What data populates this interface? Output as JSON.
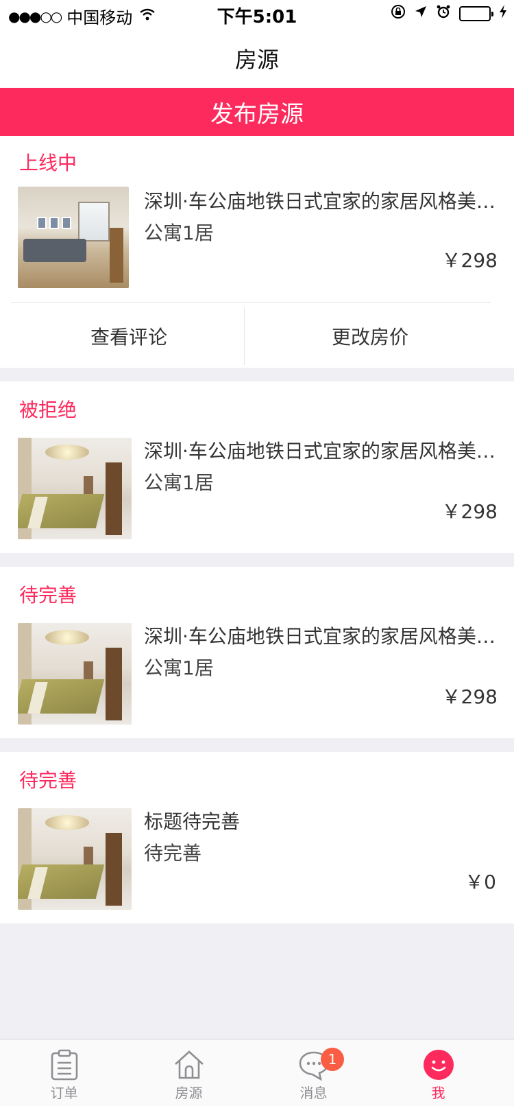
{
  "status_bar": {
    "signal": "●●●○○",
    "carrier": "中国移动",
    "time": "下午5:01"
  },
  "nav": {
    "title": "房源"
  },
  "publish_button": {
    "label": "发布房源"
  },
  "listings": [
    {
      "status": "上线中",
      "title": "深圳·车公庙地铁日式宜家的家居风格美式舒适",
      "type": "公寓1居",
      "price": "￥298",
      "actions": {
        "left": "查看评论",
        "right": "更改房价"
      }
    },
    {
      "status": "被拒绝",
      "title": "深圳·车公庙地铁日式宜家的家居风格美式舒适",
      "type": "公寓1居",
      "price": "￥298"
    },
    {
      "status": "待完善",
      "title": "深圳·车公庙地铁日式宜家的家居风格美式舒适",
      "type": "公寓1居",
      "price": "￥298"
    },
    {
      "status": "待完善",
      "title": "标题待完善",
      "type": "待完善",
      "price": "￥0"
    }
  ],
  "tabbar": {
    "tabs": [
      {
        "label": "订单",
        "icon": "clipboard-icon"
      },
      {
        "label": "房源",
        "icon": "home-icon"
      },
      {
        "label": "消息",
        "icon": "chat-icon",
        "badge": "1"
      },
      {
        "label": "我",
        "icon": "smile-icon",
        "active": true
      }
    ]
  },
  "colors": {
    "accent": "#fd2a5d",
    "badge": "#f95d43",
    "background": "#efeff4"
  }
}
